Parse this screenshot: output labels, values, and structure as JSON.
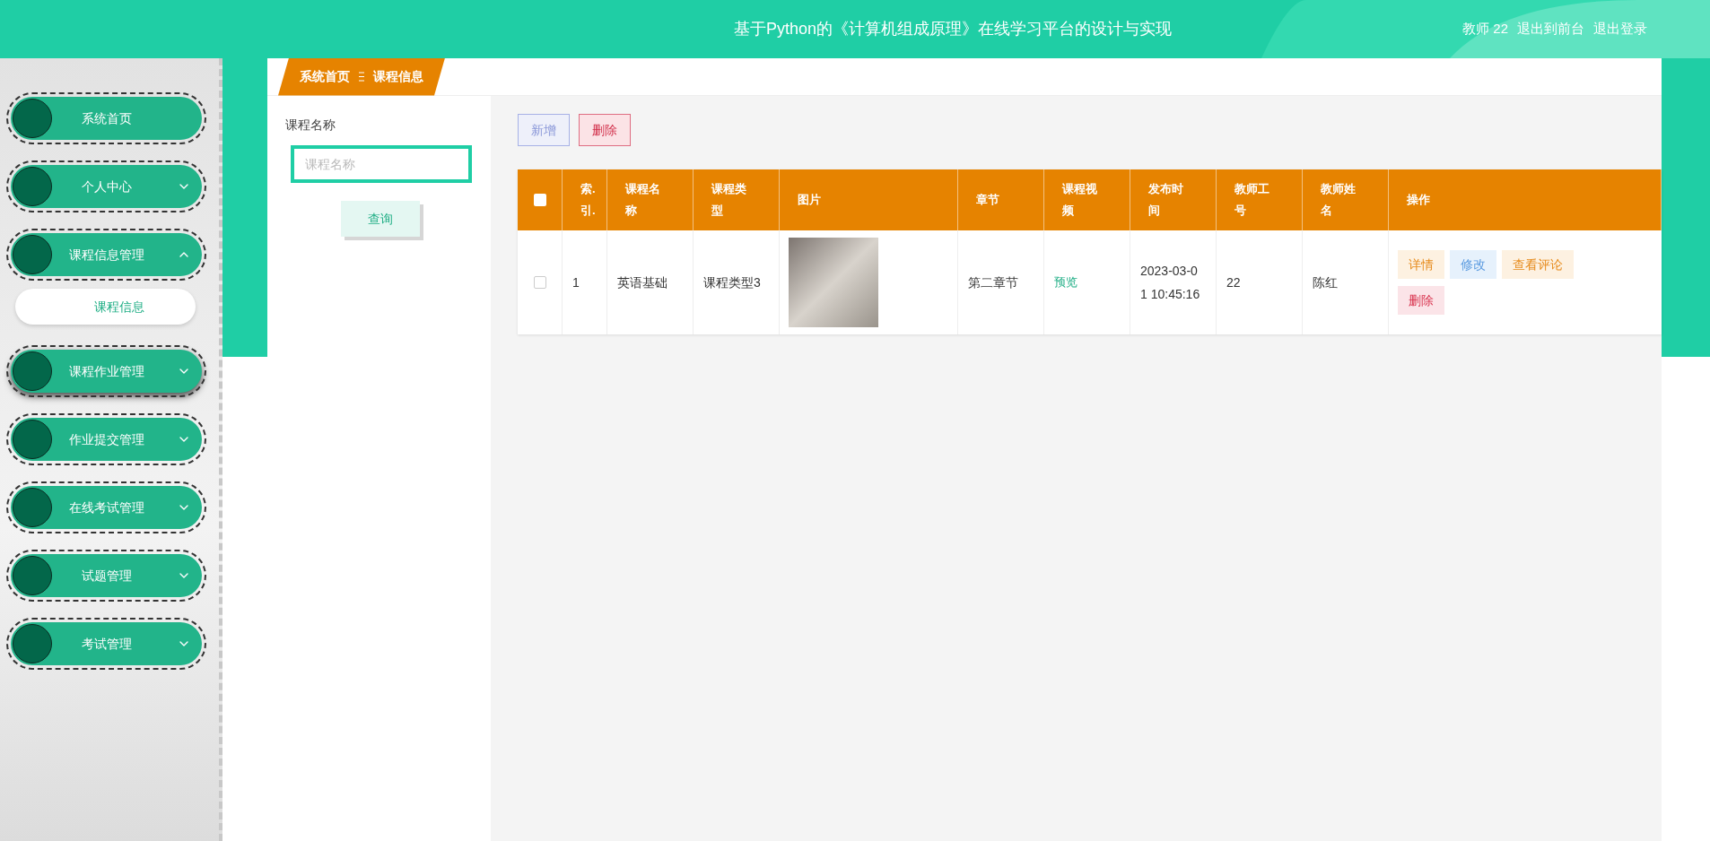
{
  "header": {
    "title": "基于Python的《计算机组成原理》在线学习平台的设计与实现",
    "user": "教师 22",
    "links": [
      "退出到前台",
      "退出登录"
    ]
  },
  "sidebar": {
    "items": [
      {
        "label": "系统首页",
        "kind": "link",
        "hovered": false
      },
      {
        "label": "个人中心",
        "kind": "menu",
        "expanded": false,
        "hovered": false
      },
      {
        "label": "课程信息管理",
        "kind": "menu",
        "expanded": true,
        "hovered": false,
        "children": [
          {
            "label": "课程信息",
            "selected": true
          }
        ]
      },
      {
        "label": "课程作业管理",
        "kind": "menu",
        "expanded": false,
        "hovered": true
      },
      {
        "label": "作业提交管理",
        "kind": "menu",
        "expanded": false,
        "hovered": false
      },
      {
        "label": "在线考试管理",
        "kind": "menu",
        "expanded": false,
        "hovered": false
      },
      {
        "label": "试题管理",
        "kind": "menu",
        "expanded": false,
        "hovered": false
      },
      {
        "label": "考试管理",
        "kind": "menu",
        "expanded": false,
        "hovered": false
      }
    ]
  },
  "breadcrumb": [
    "系统首页",
    "课程信息"
  ],
  "search": {
    "label": "课程名称",
    "placeholder": "课程名称",
    "button": "查询"
  },
  "toolbar": [
    {
      "label": "新增",
      "kind": "add"
    },
    {
      "label": "删除",
      "kind": "delete"
    }
  ],
  "table": {
    "header_checkbox": {
      "checked": false
    },
    "columns": [
      "索.引.",
      "课程名称",
      "课程类型",
      "图片",
      "章节",
      "课程视频",
      "发布时间",
      "教师工号",
      "教师姓名",
      "操作"
    ],
    "rows": [
      {
        "selected": false,
        "index": "1",
        "name": "英语基础",
        "type": "课程类型3",
        "chapter": "第二章节",
        "video": "预览",
        "time": "2023-03-01 10:45:16",
        "teacher_no": "22",
        "teacher_name": "陈红",
        "actions": [
          {
            "label": "详情",
            "kind": "detail"
          },
          {
            "label": "修改",
            "kind": "edit"
          },
          {
            "label": "查看评论",
            "kind": "comments"
          },
          {
            "label": "删除",
            "kind": "delete"
          }
        ]
      }
    ]
  }
}
